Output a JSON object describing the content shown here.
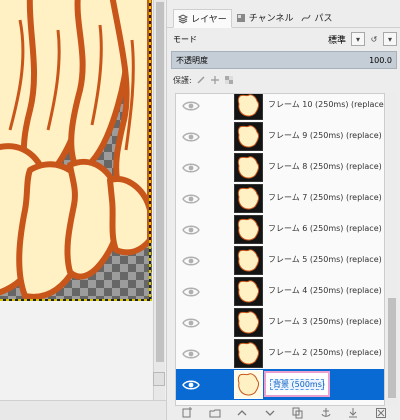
{
  "tabs": [
    {
      "label": "レイヤー",
      "icon": "layers-icon",
      "active": true
    },
    {
      "label": "チャンネル",
      "icon": "channels-icon",
      "active": false
    },
    {
      "label": "パス",
      "icon": "paths-icon",
      "active": false
    }
  ],
  "mode": {
    "label": "モード",
    "value": "標準"
  },
  "opacity": {
    "label": "不透明度",
    "value": "100.0"
  },
  "lock": {
    "label": "保護:"
  },
  "layers": [
    {
      "name": "フレーム 10 (250ms) (replace)",
      "visible": true,
      "selected": false
    },
    {
      "name": "フレーム 9 (250ms) (replace)",
      "visible": true,
      "selected": false
    },
    {
      "name": "フレーム 8 (250ms) (replace)",
      "visible": true,
      "selected": false
    },
    {
      "name": "フレーム 7 (250ms) (replace)",
      "visible": true,
      "selected": false
    },
    {
      "name": "フレーム 6 (250ms) (replace)",
      "visible": true,
      "selected": false
    },
    {
      "name": "フレーム 5 (250ms) (replace)",
      "visible": true,
      "selected": false
    },
    {
      "name": "フレーム 4 (250ms) (replace)",
      "visible": true,
      "selected": false
    },
    {
      "name": "フレーム 3 (250ms) (replace)",
      "visible": true,
      "selected": false
    },
    {
      "name": "フレーム 2 (250ms) (replace)",
      "visible": true,
      "selected": false
    },
    {
      "name": "背景 (500ms)",
      "visible": true,
      "selected": true,
      "editing": true
    }
  ],
  "bottom_bar": [
    "new-layer-icon",
    "new-layer-group-icon",
    "raise-layer-icon",
    "lower-layer-icon",
    "duplicate-layer-icon",
    "anchor-layer-icon",
    "merge-down-icon",
    "delete-layer-icon"
  ],
  "colors": {
    "selection": "#0a6ad4",
    "canvas_fill": "#fff1c4",
    "canvas_outline": "#c8561a",
    "edit_highlight": "#e8a0d0"
  }
}
